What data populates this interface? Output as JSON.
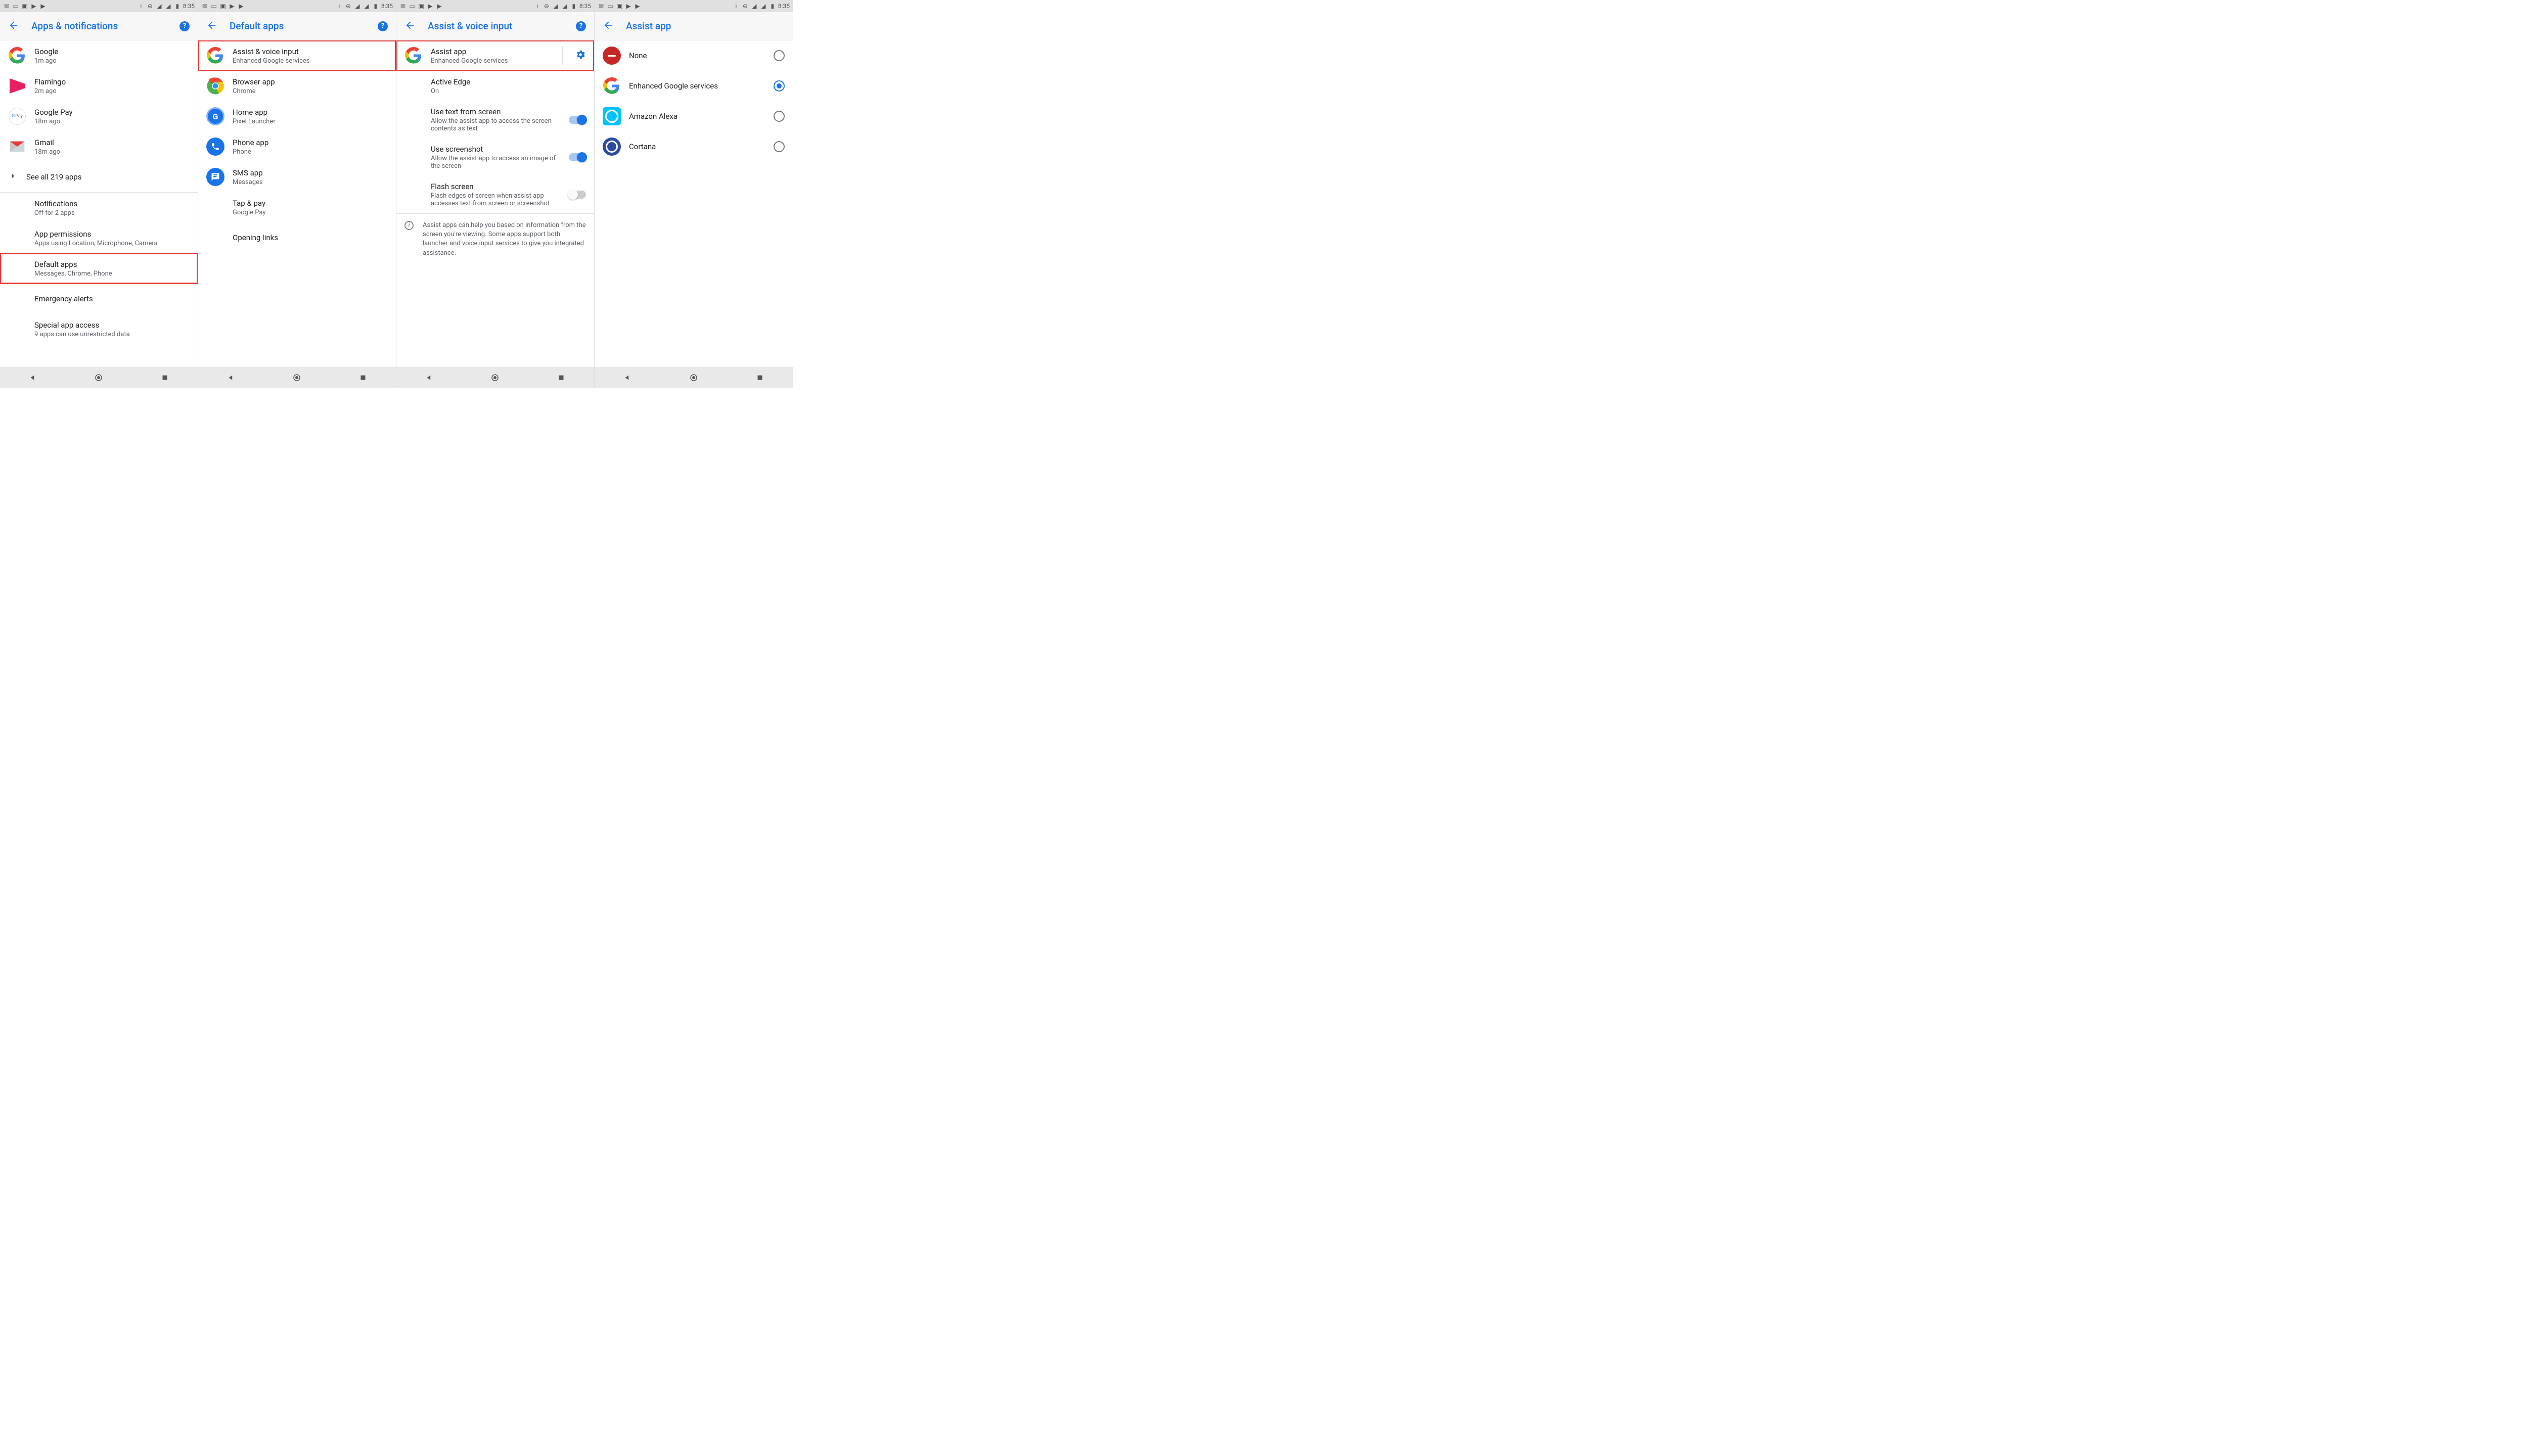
{
  "status": {
    "time": "8:35"
  },
  "screens": [
    {
      "title": "Apps & notifications",
      "has_help": true,
      "items": [
        {
          "icon": "google",
          "t1": "Google",
          "t2": "1m ago"
        },
        {
          "icon": "flamingo",
          "t1": "Flamingo",
          "t2": "2m ago"
        },
        {
          "icon": "gpay",
          "t1": "Google Pay",
          "t2": "18m ago"
        },
        {
          "icon": "gmail",
          "t1": "Gmail",
          "t2": "18m ago"
        },
        {
          "chevron": true,
          "t1": "See all 219 apps"
        },
        {
          "divider": true
        },
        {
          "indent": true,
          "t1": "Notifications",
          "t2": "Off for 2 apps"
        },
        {
          "indent": true,
          "t1": "App permissions",
          "t2": "Apps using Location, Microphone, Camera"
        },
        {
          "indent": true,
          "highlight": true,
          "t1": "Default apps",
          "t2": "Messages, Chrome, Phone"
        },
        {
          "indent": true,
          "t1": "Emergency alerts"
        },
        {
          "indent": true,
          "t1": "Special app access",
          "t2": "9 apps can use unrestricted data"
        }
      ]
    },
    {
      "title": "Default apps",
      "has_help": true,
      "items": [
        {
          "icon": "google",
          "highlight": true,
          "t1": "Assist & voice input",
          "t2": "Enhanced Google services"
        },
        {
          "icon": "chrome",
          "t1": "Browser app",
          "t2": "Chrome"
        },
        {
          "icon": "home",
          "t1": "Home app",
          "t2": "Pixel Launcher"
        },
        {
          "icon": "phone",
          "t1": "Phone app",
          "t2": "Phone"
        },
        {
          "icon": "sms",
          "t1": "SMS app",
          "t2": "Messages"
        },
        {
          "indent": true,
          "t1": "Tap & pay",
          "t2": "Google Pay"
        },
        {
          "indent": true,
          "t1": "Opening links"
        }
      ]
    },
    {
      "title": "Assist & voice input",
      "has_help": true,
      "items": [
        {
          "icon": "google",
          "highlight": true,
          "gear": true,
          "t1": "Assist app",
          "t2": "Enhanced Google services"
        },
        {
          "indent2": true,
          "t1": "Active Edge",
          "t2": "On"
        },
        {
          "indent2": true,
          "switch": "on",
          "t1": "Use text from screen",
          "t2": "Allow the assist app to access the screen contents as text"
        },
        {
          "indent2": true,
          "switch": "on",
          "t1": "Use screenshot",
          "t2": "Allow the assist app to access an image of the screen"
        },
        {
          "indent2": true,
          "switch": "off",
          "t1": "Flash screen",
          "t2": "Flash edges of screen when assist app accesses text from screen or screenshot"
        },
        {
          "divider": true
        },
        {
          "footnote": "Assist apps can help you based on information from the screen you're viewing. Some apps support both launcher and voice input services to give you integrated assistance."
        }
      ]
    },
    {
      "title": "Assist app",
      "has_help": false,
      "items": [
        {
          "icon": "none",
          "radio": "off",
          "t1": "None"
        },
        {
          "icon": "google",
          "radio": "on",
          "t1": "Enhanced Google services"
        },
        {
          "icon": "alexa",
          "radio": "off",
          "t1": "Amazon Alexa"
        },
        {
          "icon": "cortana",
          "radio": "off",
          "t1": "Cortana"
        }
      ]
    }
  ]
}
